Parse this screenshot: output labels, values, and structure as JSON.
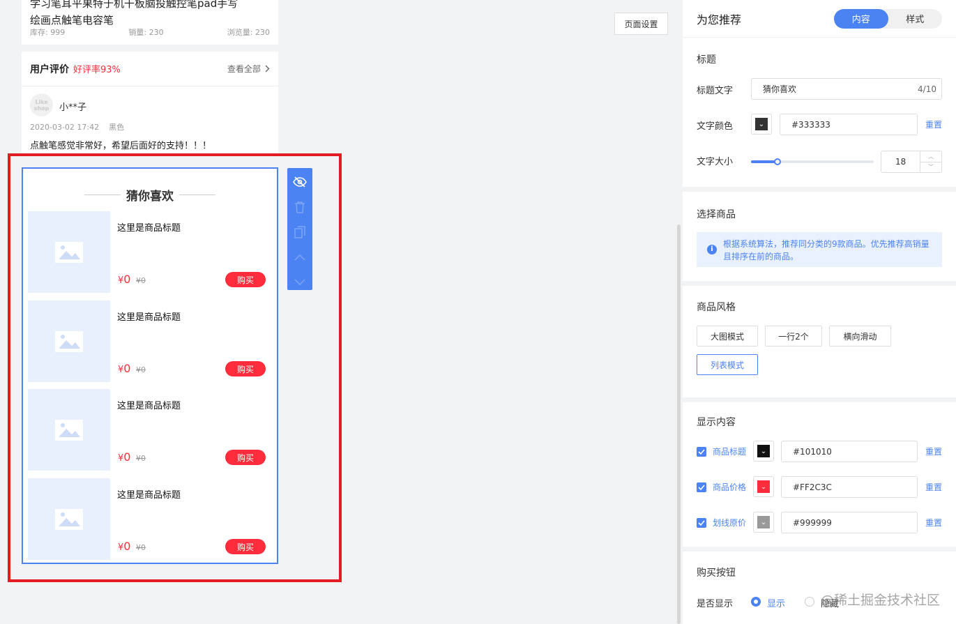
{
  "preview": {
    "product_title_line1": "学习笔耳平果特于机干板脑投触控笔pad手写",
    "product_title_line2": "绘画点触笔电容笔",
    "stats": {
      "stock": "库存: 999",
      "sales": "销量: 230",
      "views": "浏览量: 230"
    },
    "review": {
      "title": "用户评价",
      "rate": "好评率93%",
      "view_all": "查看全部",
      "avatar_text": "Like shop",
      "username": "小**子",
      "meta": "2020-03-02 17:42    黑色",
      "text": "点触笔感觉非常好，希望后面好的支持！！！"
    },
    "module": {
      "title": "猜你喜欢",
      "goods": [
        {
          "title": "这里是商品标题",
          "price": "0",
          "currency": "¥",
          "orig": "¥0",
          "buy": "购买"
        },
        {
          "title": "这里是商品标题",
          "price": "0",
          "currency": "¥",
          "orig": "¥0",
          "buy": "购买"
        },
        {
          "title": "这里是商品标题",
          "price": "0",
          "currency": "¥",
          "orig": "¥0",
          "buy": "购买"
        },
        {
          "title": "这里是商品标题",
          "price": "0",
          "currency": "¥",
          "orig": "¥0",
          "buy": "购买"
        }
      ]
    },
    "toolbar_icons": [
      "eye-hide-icon",
      "trash-icon",
      "copy-icon",
      "chevron-up-icon",
      "chevron-down-icon"
    ]
  },
  "page_settings_button": "页面设置",
  "panel": {
    "title": "为您推荐",
    "tabs": [
      "内容",
      "样式"
    ],
    "active_tab": "内容",
    "title_section": {
      "heading": "标题",
      "text_label": "标题文字",
      "text_value": "猜你喜欢",
      "text_count": "4/10",
      "color_label": "文字颜色",
      "color_value": "#333333",
      "reset": "重置",
      "size_label": "文字大小",
      "size_value": "18"
    },
    "goods_section": {
      "heading": "选择商品",
      "info": "根据系统算法，推荐同分类的9款商品。优先推荐高销量且排序在前的商品。"
    },
    "style_section": {
      "heading": "商品风格",
      "options": [
        "大图模式",
        "一行2个",
        "横向滑动",
        "列表模式"
      ],
      "active": "列表模式"
    },
    "display_section": {
      "heading": "显示内容",
      "items": [
        {
          "label": "商品标题",
          "color": "#101010",
          "reset": "重置"
        },
        {
          "label": "商品价格",
          "color": "#FF2C3C",
          "reset": "重置"
        },
        {
          "label": "划线原价",
          "color": "#999999",
          "reset": "重置"
        }
      ]
    },
    "buy_section": {
      "heading": "购买按钮",
      "show_label": "是否显示",
      "options": [
        "显示",
        "隐藏"
      ],
      "selected": "显示"
    }
  },
  "colors": {
    "accent": "#4b83f2",
    "price": "#FF2C3C",
    "frame": "#e31b23"
  },
  "watermark": "@稀土掘金技术社区"
}
